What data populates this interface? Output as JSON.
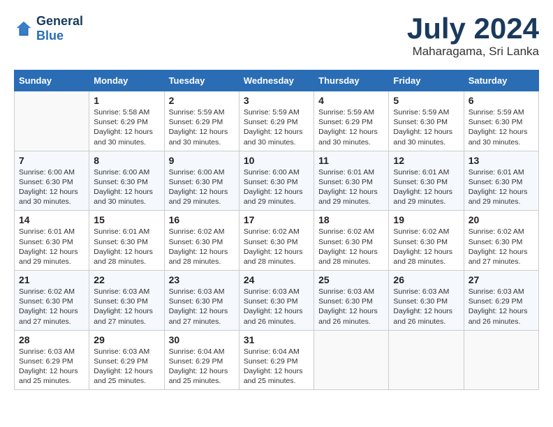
{
  "header": {
    "logo_line1": "General",
    "logo_line2": "Blue",
    "month_title": "July 2024",
    "location": "Maharagama, Sri Lanka"
  },
  "weekdays": [
    "Sunday",
    "Monday",
    "Tuesday",
    "Wednesday",
    "Thursday",
    "Friday",
    "Saturday"
  ],
  "weeks": [
    [
      {
        "day": "",
        "sunrise": "",
        "sunset": "",
        "daylight": ""
      },
      {
        "day": "1",
        "sunrise": "Sunrise: 5:58 AM",
        "sunset": "Sunset: 6:29 PM",
        "daylight": "Daylight: 12 hours and 30 minutes."
      },
      {
        "day": "2",
        "sunrise": "Sunrise: 5:59 AM",
        "sunset": "Sunset: 6:29 PM",
        "daylight": "Daylight: 12 hours and 30 minutes."
      },
      {
        "day": "3",
        "sunrise": "Sunrise: 5:59 AM",
        "sunset": "Sunset: 6:29 PM",
        "daylight": "Daylight: 12 hours and 30 minutes."
      },
      {
        "day": "4",
        "sunrise": "Sunrise: 5:59 AM",
        "sunset": "Sunset: 6:29 PM",
        "daylight": "Daylight: 12 hours and 30 minutes."
      },
      {
        "day": "5",
        "sunrise": "Sunrise: 5:59 AM",
        "sunset": "Sunset: 6:30 PM",
        "daylight": "Daylight: 12 hours and 30 minutes."
      },
      {
        "day": "6",
        "sunrise": "Sunrise: 5:59 AM",
        "sunset": "Sunset: 6:30 PM",
        "daylight": "Daylight: 12 hours and 30 minutes."
      }
    ],
    [
      {
        "day": "7",
        "sunrise": "Sunrise: 6:00 AM",
        "sunset": "Sunset: 6:30 PM",
        "daylight": "Daylight: 12 hours and 30 minutes."
      },
      {
        "day": "8",
        "sunrise": "Sunrise: 6:00 AM",
        "sunset": "Sunset: 6:30 PM",
        "daylight": "Daylight: 12 hours and 30 minutes."
      },
      {
        "day": "9",
        "sunrise": "Sunrise: 6:00 AM",
        "sunset": "Sunset: 6:30 PM",
        "daylight": "Daylight: 12 hours and 29 minutes."
      },
      {
        "day": "10",
        "sunrise": "Sunrise: 6:00 AM",
        "sunset": "Sunset: 6:30 PM",
        "daylight": "Daylight: 12 hours and 29 minutes."
      },
      {
        "day": "11",
        "sunrise": "Sunrise: 6:01 AM",
        "sunset": "Sunset: 6:30 PM",
        "daylight": "Daylight: 12 hours and 29 minutes."
      },
      {
        "day": "12",
        "sunrise": "Sunrise: 6:01 AM",
        "sunset": "Sunset: 6:30 PM",
        "daylight": "Daylight: 12 hours and 29 minutes."
      },
      {
        "day": "13",
        "sunrise": "Sunrise: 6:01 AM",
        "sunset": "Sunset: 6:30 PM",
        "daylight": "Daylight: 12 hours and 29 minutes."
      }
    ],
    [
      {
        "day": "14",
        "sunrise": "Sunrise: 6:01 AM",
        "sunset": "Sunset: 6:30 PM",
        "daylight": "Daylight: 12 hours and 29 minutes."
      },
      {
        "day": "15",
        "sunrise": "Sunrise: 6:01 AM",
        "sunset": "Sunset: 6:30 PM",
        "daylight": "Daylight: 12 hours and 28 minutes."
      },
      {
        "day": "16",
        "sunrise": "Sunrise: 6:02 AM",
        "sunset": "Sunset: 6:30 PM",
        "daylight": "Daylight: 12 hours and 28 minutes."
      },
      {
        "day": "17",
        "sunrise": "Sunrise: 6:02 AM",
        "sunset": "Sunset: 6:30 PM",
        "daylight": "Daylight: 12 hours and 28 minutes."
      },
      {
        "day": "18",
        "sunrise": "Sunrise: 6:02 AM",
        "sunset": "Sunset: 6:30 PM",
        "daylight": "Daylight: 12 hours and 28 minutes."
      },
      {
        "day": "19",
        "sunrise": "Sunrise: 6:02 AM",
        "sunset": "Sunset: 6:30 PM",
        "daylight": "Daylight: 12 hours and 28 minutes."
      },
      {
        "day": "20",
        "sunrise": "Sunrise: 6:02 AM",
        "sunset": "Sunset: 6:30 PM",
        "daylight": "Daylight: 12 hours and 27 minutes."
      }
    ],
    [
      {
        "day": "21",
        "sunrise": "Sunrise: 6:02 AM",
        "sunset": "Sunset: 6:30 PM",
        "daylight": "Daylight: 12 hours and 27 minutes."
      },
      {
        "day": "22",
        "sunrise": "Sunrise: 6:03 AM",
        "sunset": "Sunset: 6:30 PM",
        "daylight": "Daylight: 12 hours and 27 minutes."
      },
      {
        "day": "23",
        "sunrise": "Sunrise: 6:03 AM",
        "sunset": "Sunset: 6:30 PM",
        "daylight": "Daylight: 12 hours and 27 minutes."
      },
      {
        "day": "24",
        "sunrise": "Sunrise: 6:03 AM",
        "sunset": "Sunset: 6:30 PM",
        "daylight": "Daylight: 12 hours and 26 minutes."
      },
      {
        "day": "25",
        "sunrise": "Sunrise: 6:03 AM",
        "sunset": "Sunset: 6:30 PM",
        "daylight": "Daylight: 12 hours and 26 minutes."
      },
      {
        "day": "26",
        "sunrise": "Sunrise: 6:03 AM",
        "sunset": "Sunset: 6:30 PM",
        "daylight": "Daylight: 12 hours and 26 minutes."
      },
      {
        "day": "27",
        "sunrise": "Sunrise: 6:03 AM",
        "sunset": "Sunset: 6:29 PM",
        "daylight": "Daylight: 12 hours and 26 minutes."
      }
    ],
    [
      {
        "day": "28",
        "sunrise": "Sunrise: 6:03 AM",
        "sunset": "Sunset: 6:29 PM",
        "daylight": "Daylight: 12 hours and 25 minutes."
      },
      {
        "day": "29",
        "sunrise": "Sunrise: 6:03 AM",
        "sunset": "Sunset: 6:29 PM",
        "daylight": "Daylight: 12 hours and 25 minutes."
      },
      {
        "day": "30",
        "sunrise": "Sunrise: 6:04 AM",
        "sunset": "Sunset: 6:29 PM",
        "daylight": "Daylight: 12 hours and 25 minutes."
      },
      {
        "day": "31",
        "sunrise": "Sunrise: 6:04 AM",
        "sunset": "Sunset: 6:29 PM",
        "daylight": "Daylight: 12 hours and 25 minutes."
      },
      {
        "day": "",
        "sunrise": "",
        "sunset": "",
        "daylight": ""
      },
      {
        "day": "",
        "sunrise": "",
        "sunset": "",
        "daylight": ""
      },
      {
        "day": "",
        "sunrise": "",
        "sunset": "",
        "daylight": ""
      }
    ]
  ]
}
